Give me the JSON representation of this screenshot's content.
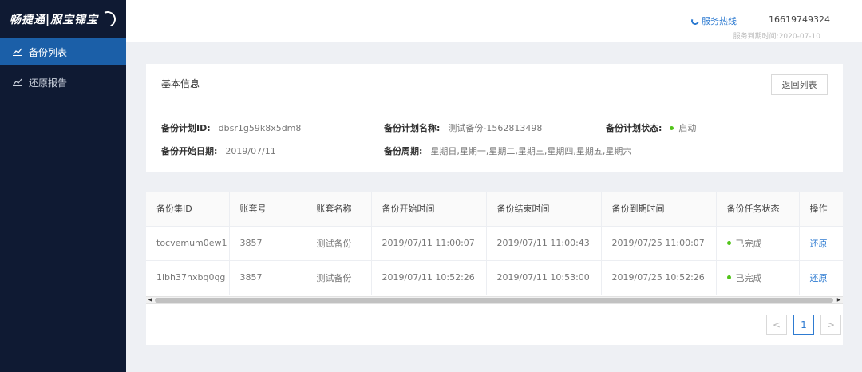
{
  "sidebar": {
    "logo": "畅捷通|服宝锦宝",
    "items": [
      {
        "label": "备份列表",
        "icon": "chart-line-icon",
        "active": true
      },
      {
        "label": "还原报告",
        "icon": "chart-line-icon",
        "active": false
      }
    ]
  },
  "header": {
    "hotline_label": "服务热线",
    "phone": "16619749324",
    "expiry": "服务到期时间:2020-07-10"
  },
  "info": {
    "title": "基本信息",
    "back_button": "返回列表",
    "fields": [
      {
        "label": "备份计划ID:",
        "value": "dbsr1g59k8x5dm8"
      },
      {
        "label": "备份计划名称:",
        "value": "测试备份-1562813498"
      },
      {
        "label": "备份计划状态:",
        "value": "启动"
      },
      {
        "label": "备份开始日期:",
        "value": "2019/07/11"
      },
      {
        "label": "备份周期:",
        "value": "星期日,星期一,星期二,星期三,星期四,星期五,星期六"
      }
    ]
  },
  "table": {
    "columns": [
      "备份集ID",
      "账套号",
      "账套名称",
      "备份开始时间",
      "备份结束时间",
      "备份到期时间",
      "备份任务状态",
      "操作"
    ],
    "rows": [
      [
        "tocvemum0ew1",
        "3857",
        "测试备份",
        "2019/07/11 11:00:07",
        "2019/07/11 11:00:43",
        "2019/07/25 11:00:07",
        "已完成",
        "还原"
      ],
      [
        "1ibh37hxbq0qg",
        "3857",
        "测试备份",
        "2019/07/11 10:52:26",
        "2019/07/11 10:53:00",
        "2019/07/25 10:52:26",
        "已完成",
        "还原"
      ]
    ]
  },
  "pagination": {
    "prev": "<",
    "current": "1",
    "next": ">"
  },
  "colors": {
    "accent": "#2e7bd1",
    "sidebar": "#0f1a33",
    "active_nav": "#1b5fa8",
    "success": "#52c41a"
  }
}
